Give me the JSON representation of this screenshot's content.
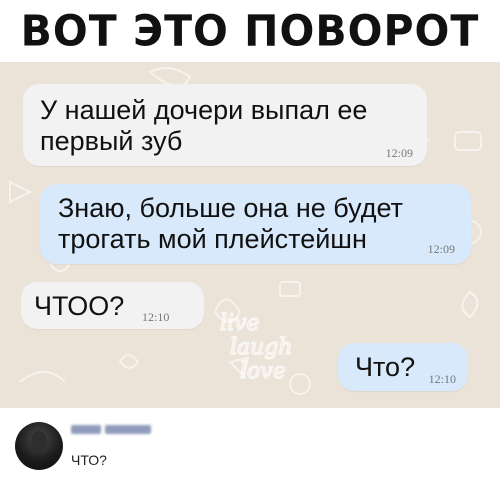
{
  "meme": {
    "title": "ВОТ ЭТО ПОВОРОТ"
  },
  "chat": {
    "messages": [
      {
        "direction": "incoming",
        "text": "У нашей дочери выпал ее\nпервый зуб",
        "time": "12:09"
      },
      {
        "direction": "outgoing",
        "text": "Знаю, больше она не будет\nтрогать мой плейстейшн",
        "time": "12:09"
      },
      {
        "direction": "incoming",
        "text": "ЧТОО?",
        "time": "12:10"
      },
      {
        "direction": "outgoing",
        "text": "Что?",
        "time": "12:10"
      }
    ],
    "colors": {
      "wallpaper": "#ece3d8",
      "incoming_bubble": "#f2f2f2",
      "outgoing_bubble": "#d8e9fb"
    }
  },
  "comment": {
    "author_icon": "avatar-photo",
    "author_name_state": "blurred",
    "text": "ЧТО?"
  }
}
